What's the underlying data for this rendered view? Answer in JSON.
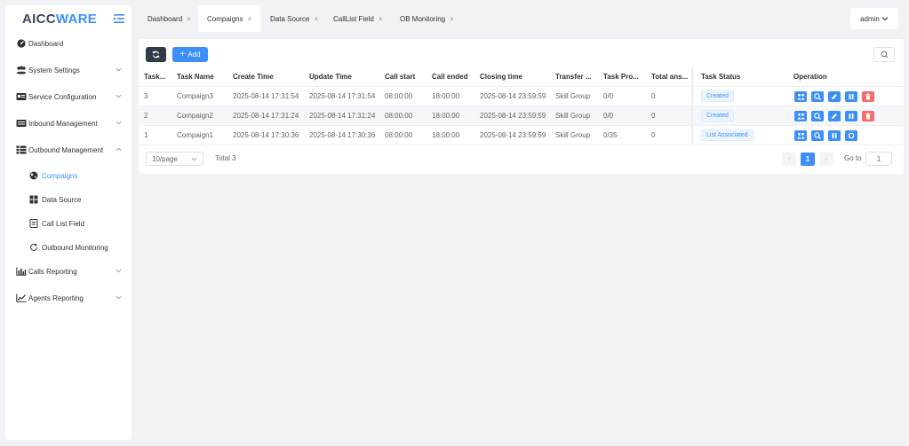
{
  "brand": {
    "part1": "AICC",
    "part2": "WARE"
  },
  "colors": {
    "accent": "#3c8ff7",
    "danger": "#f56c6c",
    "dark_button": "#313a46"
  },
  "sidebar": {
    "items": [
      {
        "label": "Dashboard",
        "icon": "dashboard-icon"
      },
      {
        "label": "System Settings",
        "icon": "users-icon"
      },
      {
        "label": "Service Configuration",
        "icon": "id-card-icon"
      },
      {
        "label": "Inbound Management",
        "icon": "inbound-icon"
      },
      {
        "label": "Outbound Management",
        "icon": "list-icon"
      },
      {
        "label": "Calls Reporting",
        "icon": "bar-chart-icon"
      },
      {
        "label": "Agents Reporting",
        "icon": "line-chart-icon"
      }
    ],
    "outbound_children": [
      {
        "label": "Compaigns",
        "icon": "globe-icon",
        "active": true
      },
      {
        "label": "Data Source",
        "icon": "grid-icon"
      },
      {
        "label": "Call List Field",
        "icon": "form-icon"
      },
      {
        "label": "Outbound Monitoring",
        "icon": "refresh-circle-icon"
      }
    ]
  },
  "tabs": [
    {
      "label": "Dashboard"
    },
    {
      "label": "Compaigns",
      "active": true
    },
    {
      "label": "Data Source"
    },
    {
      "label": "CallList Field"
    },
    {
      "label": "OB Monitoring"
    }
  ],
  "user": {
    "name": "admin"
  },
  "toolbar": {
    "add_label": "Add"
  },
  "table": {
    "columns": [
      "Task...",
      "Task Name",
      "Create Time",
      "Update Time",
      "Call start",
      "Call ended",
      "Closing time",
      "Transfer ...",
      "Task Pro...",
      "Total ans...",
      "Task Status",
      "Operation"
    ],
    "rows": [
      {
        "id": "3",
        "name": "Compaign3",
        "create": "2025-08-14 17:31:54",
        "update": "2025-08-14 17:31:54",
        "start": "08:00:00",
        "end": "18:00:00",
        "closing": "2025-08-14 23:59:59",
        "transfer": "Skill Group",
        "progress": "0/0",
        "total": "0",
        "status": "Created"
      },
      {
        "id": "2",
        "name": "Compaign2",
        "create": "2025-08-14 17:31:24",
        "update": "2025-08-14 17:31:24",
        "start": "08:00:00",
        "end": "18:00:00",
        "closing": "2025-08-14 23:59:59",
        "transfer": "Skill Group",
        "progress": "0/0",
        "total": "0",
        "status": "Created"
      },
      {
        "id": "1",
        "name": "Compaign1",
        "create": "2025-08-14 17:30:36",
        "update": "2025-08-14 17:30:36",
        "start": "08:00:00",
        "end": "18:00:00",
        "closing": "2025-08-14 23:59:59",
        "transfer": "Skill Group",
        "progress": "0/35",
        "total": "0",
        "status": "List Associated"
      }
    ]
  },
  "pagination": {
    "page_size": "10/page",
    "total": "Total 3",
    "current": "1",
    "goto_label": "Go to",
    "goto_value": "1"
  }
}
